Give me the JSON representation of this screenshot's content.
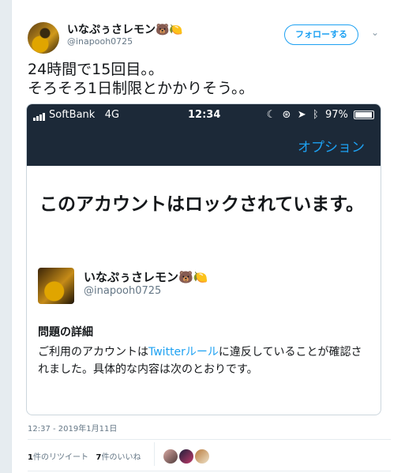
{
  "tweet": {
    "author_name": "いなぷぅさレモン🐻🍋",
    "author_handle": "@inapooh0725",
    "follow_label": "フォローする",
    "text_line1": "24時間で15回目。。",
    "text_line2": "そろそろ1日制限とかかりそう。。",
    "timestamp": "12:37 - 2019年1月11日",
    "retweets_count": "1",
    "retweets_label": "件のリツイート",
    "likes_count": "7",
    "likes_label": "件のいいね"
  },
  "screenshot": {
    "status": {
      "carrier": "SoftBank",
      "network": "4G",
      "time": "12:34",
      "battery": "97%"
    },
    "options_label": "オプション",
    "lock_title": "このアカウントはロックされています。",
    "account_name": "いなぷぅさレモン🐻🍋",
    "account_handle": "@inapooh0725",
    "details_heading": "問題の詳細",
    "details_text_pre": "ご利用のアカウントは",
    "details_link": "Twitterルール",
    "details_text_post": "に違反していることが確認されました。具体的な内容は次のとおりです。"
  },
  "icons": [
    "avatar",
    "chevron-down-icon",
    "signal-icon",
    "moon-icon",
    "lock-rotation-icon",
    "location-icon",
    "bluetooth-icon",
    "battery-icon"
  ],
  "colors": {
    "accent": "#1da1f2",
    "ios_bar": "#1c2938",
    "muted": "#657786"
  }
}
